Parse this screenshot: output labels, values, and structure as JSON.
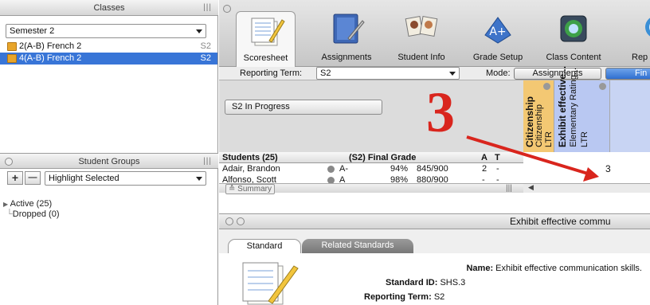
{
  "classes_pane": {
    "title": "Classes",
    "semester": "Semester 2",
    "items": [
      {
        "label": "2(A-B) French 2",
        "term": "S2",
        "selected": false
      },
      {
        "label": "4(A-B) French 2",
        "term": "S2",
        "selected": true
      }
    ]
  },
  "groups_pane": {
    "title": "Student Groups",
    "add_label": "+",
    "remove_label": "—",
    "filter": "Highlight Selected",
    "tree": [
      "Active (25)",
      "Dropped (0)"
    ]
  },
  "tabs": [
    {
      "label": "Scoresheet",
      "icon": "scoresheet-icon",
      "active": true
    },
    {
      "label": "Assignments",
      "icon": "assignments-icon",
      "active": false
    },
    {
      "label": "Student Info",
      "icon": "student-info-icon",
      "active": false
    },
    {
      "label": "Grade Setup",
      "icon": "grade-setup-icon",
      "active": false
    },
    {
      "label": "Class Content",
      "icon": "class-content-icon",
      "active": false
    },
    {
      "label": "Rep",
      "icon": "reports-icon",
      "active": false
    }
  ],
  "term_bar": {
    "reporting_term_label": "Reporting Term:",
    "reporting_term_value": "S2",
    "mode_label": "Mode:",
    "mode_assignments": "Assignments",
    "mode_final": "Fin"
  },
  "status_button": "S2 In Progress",
  "annotation": {
    "number": "3",
    "color": "#d9251d"
  },
  "standard_columns": [
    {
      "title": "Citizenship",
      "subtitle": "Citizenship",
      "type": "LTR",
      "color": "#f3c873"
    },
    {
      "title": "Exhibit effective...",
      "subtitle": "Elementary Rating...",
      "type": "LTR",
      "color": "#b9c8f2"
    }
  ],
  "grid": {
    "headers": {
      "students": "Students (25)",
      "final_grade": "(S2) Final Grade",
      "a": "A",
      "t": "T"
    },
    "rows": [
      {
        "name": "Adair, Brandon",
        "letter": "A-",
        "percent": "94%",
        "points": "845/900",
        "a": "2",
        "t": "-",
        "score": "3"
      },
      {
        "name": "Alfonso, Scott",
        "letter": "A",
        "percent": "98%",
        "points": "880/900",
        "a": "-",
        "t": "-",
        "score": ""
      }
    ],
    "summary_label": "Summary"
  },
  "detail": {
    "title": "Exhibit effective commu",
    "tabs": [
      "Standard",
      "Related Standards"
    ],
    "name_label": "Name:",
    "name_value": "Exhibit effective communication skills.",
    "id_label": "Standard ID:",
    "id_value": "SHS.3",
    "term_label": "Reporting Term:",
    "term_value": "S2"
  },
  "colors": {
    "selection": "#3875d7",
    "accent_bar": "#f6a200"
  }
}
